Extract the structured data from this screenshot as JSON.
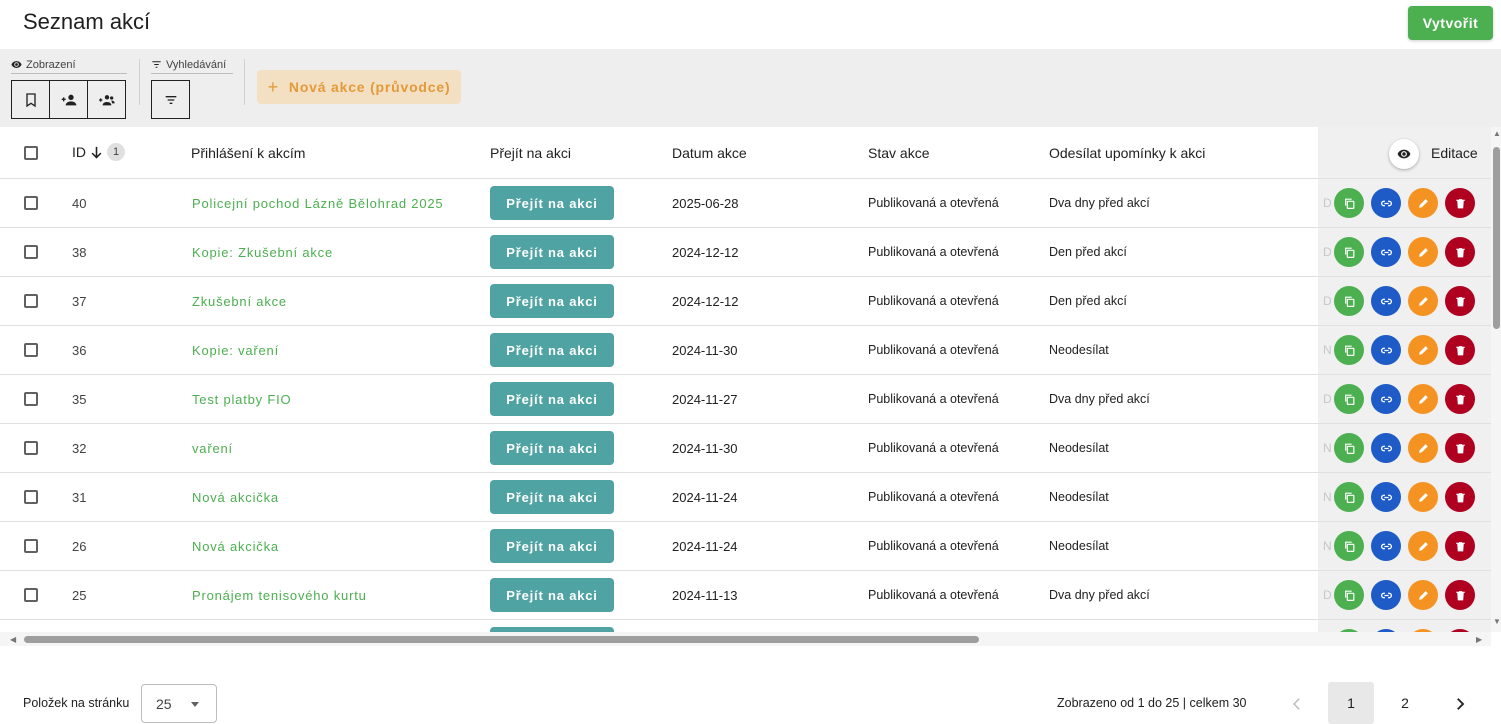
{
  "header": {
    "title": "Seznam akcí",
    "create_label": "Vytvořit"
  },
  "toolbar": {
    "view_label": "Zobrazení",
    "search_label": "Vyhledávání",
    "wizard_label": "Nová akce (průvodce)",
    "wizard_icon": "+"
  },
  "table": {
    "columns": {
      "id": "ID",
      "sort_badge": "1",
      "name": "Přihlášení k akcím",
      "go": "Přejít na akci",
      "date": "Datum akce",
      "state": "Stav akce",
      "remind": "Odesílat upomínky k akci",
      "edit": "Editace"
    },
    "go_button_label": "Přejít na akci",
    "rows": [
      {
        "id": "40",
        "name": "Policejní pochod Lázně Bělohrad 2025",
        "date": "2025-06-28",
        "state": "Publikovaná a otevřená",
        "remind": "Dva dny před akcí",
        "ghost": "D"
      },
      {
        "id": "38",
        "name": "Kopie: Zkušební akce",
        "date": "2024-12-12",
        "state": "Publikovaná a otevřená",
        "remind": "Den před akcí",
        "ghost": "D"
      },
      {
        "id": "37",
        "name": "Zkušební akce",
        "date": "2024-12-12",
        "state": "Publikovaná a otevřená",
        "remind": "Den před akcí",
        "ghost": "D"
      },
      {
        "id": "36",
        "name": "Kopie: vaření",
        "date": "2024-11-30",
        "state": "Publikovaná a otevřená",
        "remind": "Neodesílat",
        "ghost": "N"
      },
      {
        "id": "35",
        "name": "Test platby FIO",
        "date": "2024-11-27",
        "state": "Publikovaná a otevřená",
        "remind": "Dva dny před akcí",
        "ghost": "D"
      },
      {
        "id": "32",
        "name": "vaření",
        "date": "2024-11-30",
        "state": "Publikovaná a otevřená",
        "remind": "Neodesílat",
        "ghost": "N"
      },
      {
        "id": "31",
        "name": "Nová akcička",
        "date": "2024-11-24",
        "state": "Publikovaná a otevřená",
        "remind": "Neodesílat",
        "ghost": "N"
      },
      {
        "id": "26",
        "name": "Nová akcička",
        "date": "2024-11-24",
        "state": "Publikovaná a otevřená",
        "remind": "Neodesílat",
        "ghost": "N"
      },
      {
        "id": "25",
        "name": "Pronájem tenisového kurtu",
        "date": "2024-11-13",
        "state": "Publikovaná a otevřená",
        "remind": "Dva dny před akcí",
        "ghost": "D"
      }
    ]
  },
  "footer": {
    "per_page_label": "Položek na stránku",
    "per_page_value": "25",
    "range_text": "Zobrazeno od 1 do 25 | celkem 30",
    "pages": [
      "1",
      "2"
    ],
    "current_page": "1"
  },
  "colors": {
    "primary_green": "#4caf50",
    "teal": "#4fa3a3",
    "blue": "#1e5bc6",
    "orange": "#f59322",
    "red": "#b00020",
    "wizard_bg": "#f3dfc2",
    "wizard_text": "#e39a3b"
  }
}
